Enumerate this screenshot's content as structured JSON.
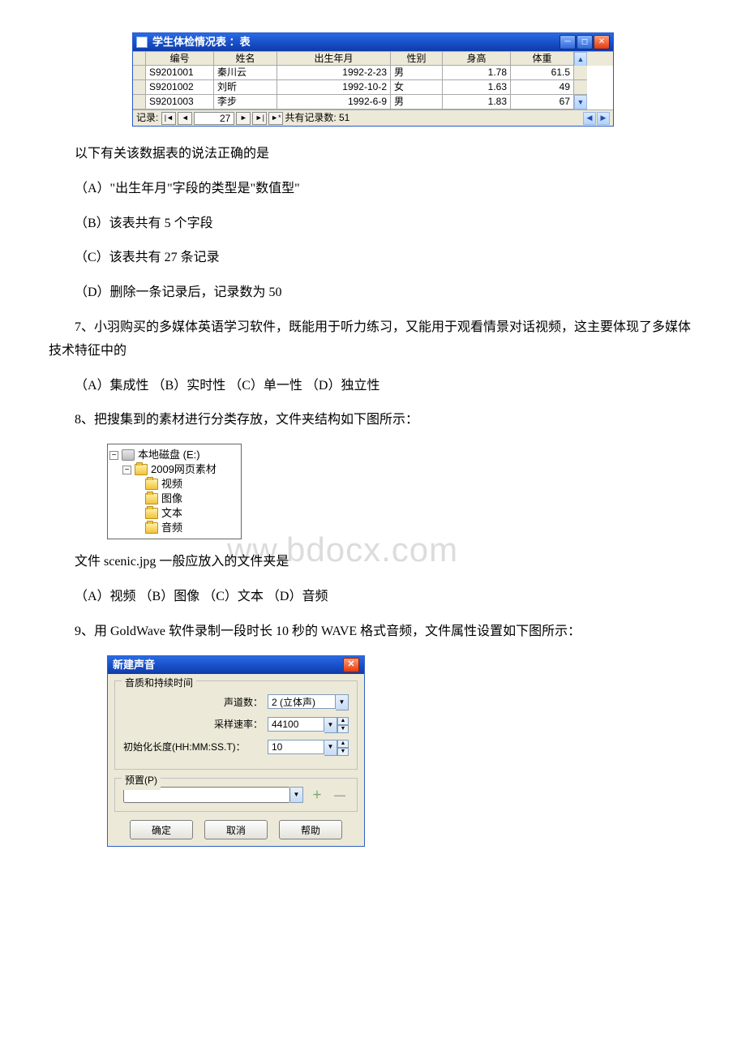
{
  "access": {
    "title": "学生体检情况表  ：表",
    "columns": [
      "编号",
      "姓名",
      "出生年月",
      "性别",
      "身高",
      "体重"
    ],
    "rows": [
      {
        "id": "S9201001",
        "name": "秦川云",
        "birth": "1992-2-23",
        "sex": "男",
        "height": "1.78",
        "weight": "61.5"
      },
      {
        "id": "S9201002",
        "name": "刘昕",
        "birth": "1992-10-2",
        "sex": "女",
        "height": "1.63",
        "weight": "49"
      },
      {
        "id": "S9201003",
        "name": "李步",
        "birth": "1992-6-9",
        "sex": "男",
        "height": "1.83",
        "weight": "67"
      }
    ],
    "nav": {
      "label": "记录:",
      "current": "27",
      "total_label": "共有记录数: 51"
    }
  },
  "questions": {
    "q6_intro": "以下有关该数据表的说法正确的是",
    "q6_a": "（A）\"出生年月\"字段的类型是\"数值型\"",
    "q6_b": "（B）该表共有 5 个字段",
    "q6_c": "（C）该表共有 27 条记录",
    "q6_d": "（D）删除一条记录后，记录数为 50",
    "q7": "7、小羽购买的多媒体英语学习软件，既能用于听力练习，又能用于观看情景对话视频，这主要体现了多媒体技术特征中的",
    "q7_opts": "（A）集成性 （B）实时性 （C）单一性 （D）独立性",
    "q8": "8、把搜集到的素材进行分类存放，文件夹结构如下图所示：",
    "q8_tail": "文件 scenic.jpg 一般应放入的文件夹是",
    "q8_opts": "（A）视频 （B）图像 （C）文本 （D）音频",
    "q9": "9、用 GoldWave 软件录制一段时长 10 秒的 WAVE 格式音频，文件属性设置如下图所示："
  },
  "tree": {
    "disk": "本地磁盘 (E:)",
    "root": "2009网页素材",
    "children": [
      "视频",
      "图像",
      "文本",
      "音频"
    ]
  },
  "goldwave": {
    "title": "新建声音",
    "group1": "音质和持续时间",
    "channels_label": "声道数：",
    "channels_value": "2 (立体声)",
    "rate_label": "采样速率：",
    "rate_value": "44100",
    "length_label": "初始化长度(HH:MM:SS.T)：",
    "length_value": "10",
    "group2": "预置(P)",
    "btn_ok": "确定",
    "btn_cancel": "取消",
    "btn_help": "帮助"
  },
  "watermark": "ww.bdocx.com"
}
